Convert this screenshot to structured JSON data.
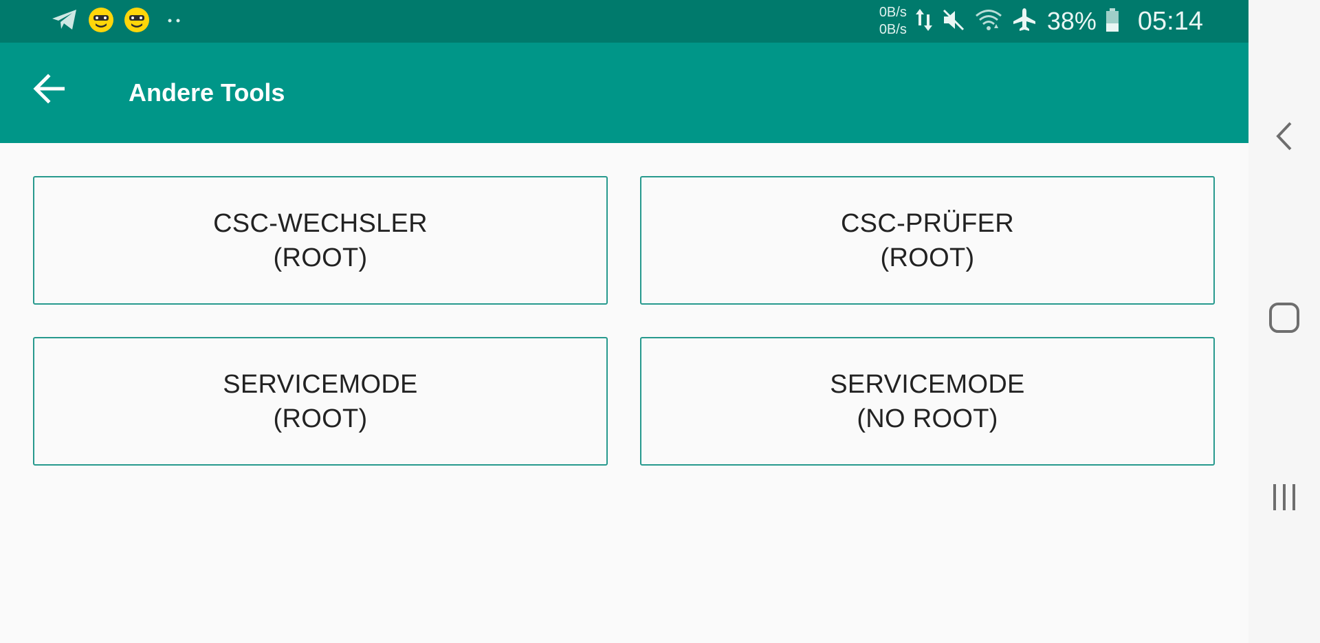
{
  "status_bar": {
    "net_up": "0B/s",
    "net_down": "0B/s",
    "battery_percent": "38%",
    "time": "05:14",
    "icons": [
      "telegram-icon",
      "app-face-icon",
      "app-face-icon",
      "more-dots-icon",
      "data-transfer-icon",
      "mute-icon",
      "wifi-icon",
      "airplane-icon",
      "battery-icon"
    ]
  },
  "app_bar": {
    "title": "Andere Tools",
    "back_icon": "arrow-left-icon"
  },
  "tools": [
    {
      "line1": "CSC-WECHSLER",
      "line2": "(ROOT)"
    },
    {
      "line1": "CSC-PRÜFER",
      "line2": "(ROOT)"
    },
    {
      "line1": "SERVICEMODE",
      "line2": "(ROOT)"
    },
    {
      "line1": "SERVICEMODE",
      "line2": "(NO ROOT)"
    }
  ],
  "nav_bar": {
    "icons": [
      "back-chevron-icon",
      "home-icon",
      "recents-icon"
    ]
  },
  "colors": {
    "status_bar": "#007a6c",
    "app_bar": "#009688",
    "button_border": "#26998d",
    "background": "#fafafa",
    "nav_bar": "#f6f6f6"
  }
}
